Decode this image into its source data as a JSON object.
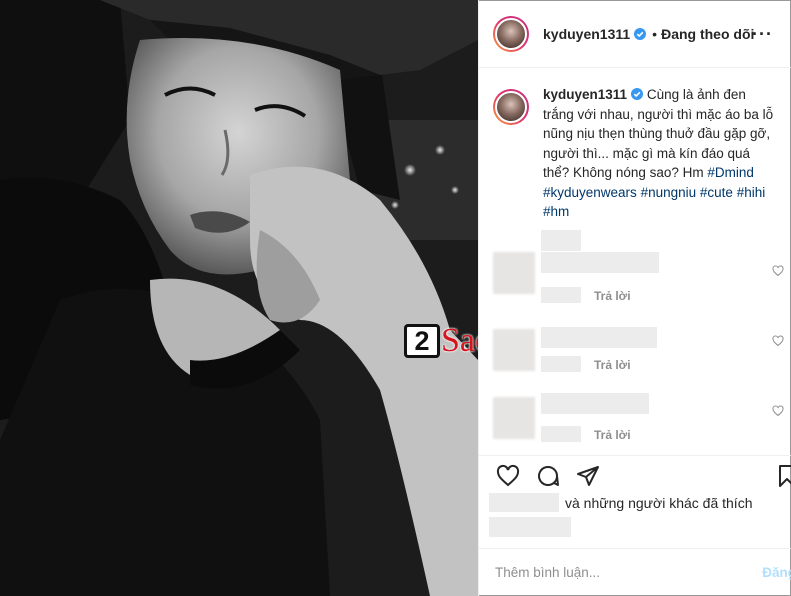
{
  "post": {
    "username": "kyduyen1311",
    "verified": true,
    "follow_state": "Đang theo dõi",
    "more_icon": "more-dots-icon",
    "caption_intro": "Cùng là ảnh đen trắng với nhau, người thì mặc áo ba lỗ nũng nịu thẹn thùng thuở đầu gặp gỡ, người thì... mặc gì mà kín đáo quá thể? Không nóng sao? Hm ",
    "hashtags": [
      "#Dmind",
      "#kyduyenwears",
      "#nungniu",
      "#cute",
      "#hihi",
      "#hm"
    ],
    "accent_color": "#00376b"
  },
  "comments": {
    "reply_label_1": "Trả lời",
    "reply_label_2": "Trả lời",
    "reply_label_3": "Trả lời"
  },
  "likes": {
    "suffix": "và những người khác đã thích"
  },
  "composer": {
    "placeholder": "Thêm bình luận...",
    "post_label": "Đăng"
  },
  "watermark": {
    "digit": "2",
    "text": "Sao",
    "color": "#d6141e"
  }
}
